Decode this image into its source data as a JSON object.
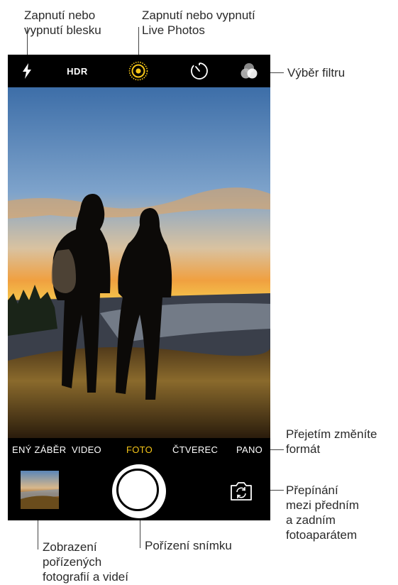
{
  "callouts": {
    "flash": "Zapnutí nebo\nvypnutí blesku",
    "live_photos": "Zapnutí nebo vypnutí\nLive Photos",
    "filter": "Výběr filtru",
    "swipe_format": "Přejetím změníte\nformát",
    "switch_camera": "Přepínání\nmezi předním\na zadním\nfotoaparátem",
    "view_photos": "Zobrazení\npořízených\nfotografií a videí",
    "take_photo": "Pořízení snímku"
  },
  "topbar": {
    "hdr_label": "HDR",
    "icons": [
      "flash-icon",
      "live-photos-icon",
      "timer-icon",
      "filters-icon"
    ],
    "live_color": "#f5c518"
  },
  "modes": {
    "items": [
      "ENÝ ZÁBĚR",
      "VIDEO",
      "FOTO",
      "ČTVEREC",
      "PANO"
    ],
    "active": "FOTO",
    "active_color": "#f5c518"
  },
  "bottombar": {
    "icons": [
      "photo-thumbnail",
      "shutter-button",
      "camera-switch-icon"
    ]
  }
}
